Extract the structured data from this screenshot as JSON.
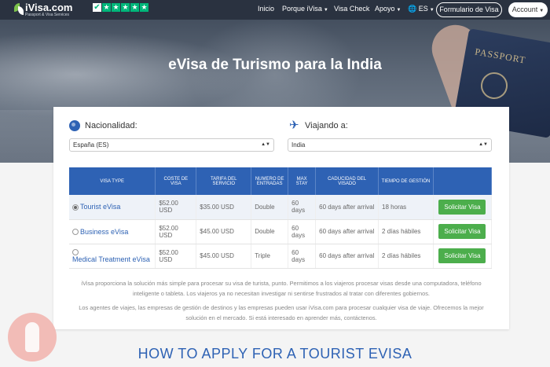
{
  "nav": {
    "logo_text": "iVisa.com",
    "logo_sub": "Passport & Visa Services",
    "items": [
      "Inicio",
      "Porque iVisa",
      "Visa Check",
      "Apoyo",
      "ES"
    ],
    "form_button": "Formulario de Visa",
    "account_button": "Account"
  },
  "hero": {
    "title": "eVisa de Turismo para la India",
    "passport_text": "PASSPORT"
  },
  "form": {
    "nationality_label": "Nacionalidad:",
    "nationality_value": "España (ES)",
    "destination_label": "Viajando a:",
    "destination_value": "India"
  },
  "table": {
    "headers": [
      "VISA TYPE",
      "COSTE DE VISA",
      "TARIFA DEL SERVICIO",
      "NUMERO DE ENTRADAS",
      "MAX STAY",
      "CADUCIDAD DEL VISADO",
      "TIEMPO DE GESTIÓN",
      ""
    ],
    "rows": [
      {
        "name": "Tourist eVisa",
        "cost": "$52.00 USD",
        "fee": "$35.00 USD",
        "entries": "Double",
        "stay": "60 days",
        "expiry": "60 days after arrival",
        "time": "18 horas",
        "button": "Solicitar Visa",
        "selected": true
      },
      {
        "name": "Business eVisa",
        "cost": "$52.00 USD",
        "fee": "$45.00 USD",
        "entries": "Double",
        "stay": "60 days",
        "expiry": "60 days after arrival",
        "time": "2 días hábiles",
        "button": "Solicitar Visa",
        "selected": false
      },
      {
        "name": "Medical Treatment eVisa",
        "cost": "$52.00 USD",
        "fee": "$45.00 USD",
        "entries": "Triple",
        "stay": "60 days",
        "expiry": "60 days after arrival",
        "time": "2 días hábiles",
        "button": "Solicitar Visa",
        "selected": false
      }
    ]
  },
  "text": {
    "para1": "iVisa proporciona la solución más simple para procesar su visa de turista, punto. Permitimos a los viajeros procesar visas desde una computadora, teléfono inteligente o tableta. Los viajeros ya no necesitan investigar ni sentirse frustrados al tratar con diferentes gobiernos.",
    "para2": "Los agentes de viajes, las empresas de gestión de destinos y las empresas pueden usar iVisa.com para procesar cualquier visa de viaje. Ofrecemos la mejor solución en el mercado. Si está interesado en aprender más, contáctenos.",
    "howto": "HOW TO APPLY FOR A TOURIST EVISA"
  },
  "colors": {
    "primary": "#2e62b4",
    "success": "#4cae4c",
    "nav_bg": "#2a3240",
    "trustpilot": "#00b67a"
  }
}
